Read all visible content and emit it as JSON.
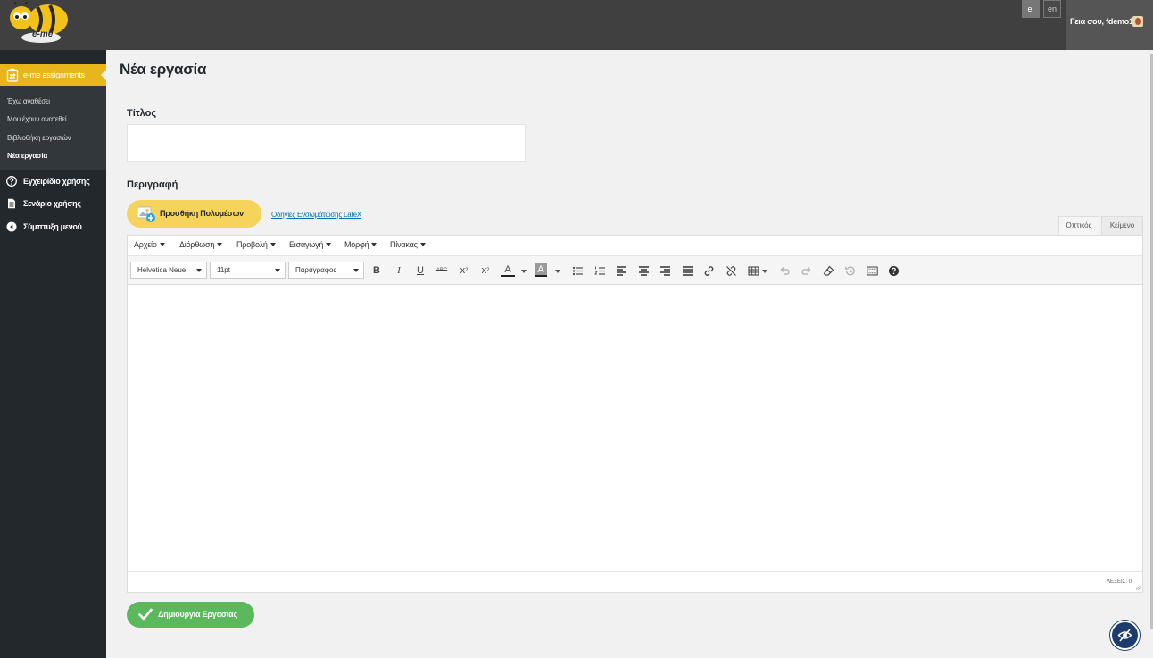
{
  "header": {
    "logo_text": "e-me",
    "languages": [
      "el",
      "en"
    ],
    "active_language": "el",
    "greeting": "Γεια σου, fdemo1"
  },
  "sidebar": {
    "main_item": "e-me assignments",
    "sub_items": [
      {
        "label": "Έχω αναθέσει",
        "active": false
      },
      {
        "label": "Μου έχουν ανατεθεί",
        "active": false
      },
      {
        "label": "Βιβλιοθήκη εργασιών",
        "active": false
      },
      {
        "label": "Νέα εργασία",
        "active": true
      }
    ],
    "items": [
      {
        "label": "Εγχειρίδιο χρήσης",
        "icon": "help-icon"
      },
      {
        "label": "Σενάριο χρήσης",
        "icon": "document-icon"
      },
      {
        "label": "Σύμπτυξη μενού",
        "icon": "collapse-icon"
      }
    ]
  },
  "main": {
    "page_title": "Νέα εργασία",
    "title_label": "Τίτλος",
    "title_value": "",
    "description_label": "Περιγραφή",
    "add_media_label": "Προσθήκη Πολυμέσων",
    "latex_link": "Οδηγίες Ενσωμάτωσης LateX",
    "tabs": [
      "Οπτικός",
      "Κείμενο"
    ],
    "active_tab": "Οπτικός",
    "create_button": "Δημιουργία Εργασίας"
  },
  "editor": {
    "menus": [
      "Αρχείο",
      "Διόρθωση",
      "Προβολή",
      "Εισαγωγή",
      "Μορφή",
      "Πίνακας"
    ],
    "font_family": "Helvetica Neue",
    "font_size": "11pt",
    "block_format": "Παράγραφος",
    "toolbar_icons": [
      "bold-icon",
      "italic-icon",
      "underline-icon",
      "strikethrough-icon",
      "superscript-icon",
      "subscript-icon",
      "text-color-icon",
      "background-color-icon",
      "bullet-list-icon",
      "numbered-list-icon",
      "align-left-icon",
      "align-center-icon",
      "align-right-icon",
      "align-justify-icon",
      "link-icon",
      "unlink-icon",
      "table-icon",
      "undo-icon",
      "redo-icon",
      "clear-format-icon",
      "restore-draft-icon",
      "toolbar-toggle-icon",
      "help-icon"
    ],
    "word_count": "ΛΕΞΕΙΣ: 0"
  },
  "colors": {
    "accent": "#e7b61a",
    "sidebar_bg": "#23282d",
    "topbar_bg": "#404040",
    "create_green": "#5cb85c",
    "media_yellow": "#f6d35b"
  }
}
